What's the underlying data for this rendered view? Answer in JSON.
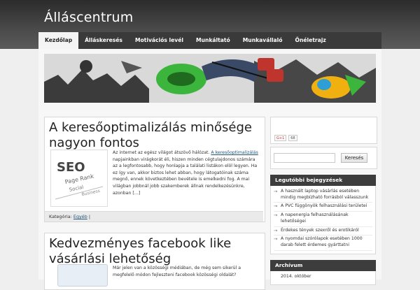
{
  "site": {
    "title": "Álláscentrum"
  },
  "nav": {
    "items": [
      {
        "label": "Kezdőlap",
        "active": true
      },
      {
        "label": "Álláskeresés"
      },
      {
        "label": "Motivációs levél"
      },
      {
        "label": "Munkáltató"
      },
      {
        "label": "Munkavállaló"
      },
      {
        "label": "Önéletrajz"
      }
    ]
  },
  "posts": [
    {
      "title": "A keresőoptimalizálás minősége nagyon fontos",
      "excerpt_pre": "Az internet az egész világot átszövő hálózat. ",
      "excerpt_link": "A keresőoptimalizálás",
      "excerpt_post": " napjainkban virágkorát éli, hiszen minden cégtulajdonos számára az a legfontosabb, hogy honlapja a találati listákon elöl legyen. Ha ez így van, akkor biztos lehet abban, hogy látogatóinak száma megnő, ennek következtében bevétele is emelkedni fog. A mai világban jobbnál jobb szakemberek állnak rendelkezésünkre, azonban […]",
      "meta_label": "Kategória: ",
      "meta_category": "Egyéb",
      "meta_sep": " |",
      "thumb_words": [
        "SEO",
        "Page Rank",
        "Social",
        "Business"
      ]
    },
    {
      "title": "Kedvezményes facebook like vásárlási lehetőség",
      "excerpt": "Már jelen van a közösségi médiában, de még sem sikerül a megfelelő módon fejleszteni facebook közösségi oldalát?"
    }
  ],
  "sidebar": {
    "gplus": {
      "label": "G+1",
      "count": "68"
    },
    "search": {
      "placeholder": "",
      "button_label": "Keresés"
    },
    "recent": {
      "title": "Legutóbbi bejegyzések",
      "items": [
        "A használt laptop vásárlás esetében mindig megbízható forrásból válasszunk",
        "A PVC függönyök felhasználási területei",
        "A napenergia felhasználásának lehetőségei",
        "Érdekes tények szexről és erotikáról",
        "A nyomdai szórólapok esetében 1000 darab felett érdemes gyárttatni"
      ]
    },
    "archive": {
      "title": "Archívum",
      "items": [
        "2014. október"
      ]
    }
  },
  "colors": {
    "topbar": "#3a3a3a",
    "accent_link": "#225577",
    "widget_head": "#3d3d3d"
  }
}
